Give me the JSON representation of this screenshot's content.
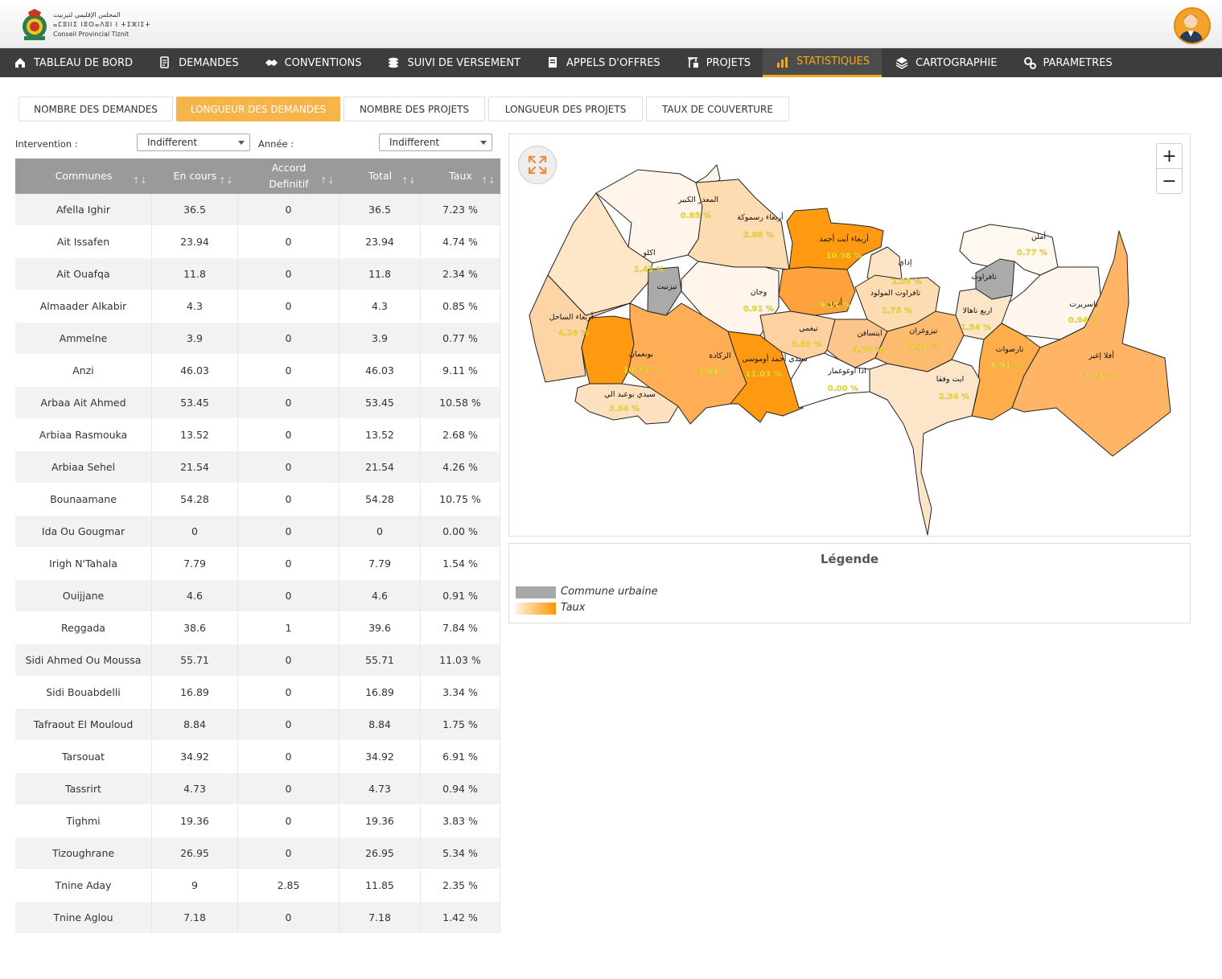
{
  "header": {
    "logo_line1": "المجلس الإقليمي لتيزنيت",
    "logo_line2": "ⴰⵎⵓⵏⵏⵉ ⵏⵓⵙⴰⴷⵓⵏ ⵏ ⵜⵉⵣⵏⵉⵜ",
    "logo_line3": "Conseil Provincial Tiznit"
  },
  "nav": [
    {
      "label": "TABLEAU DE BORD",
      "icon": "home-icon"
    },
    {
      "label": "DEMANDES",
      "icon": "document-edit-icon"
    },
    {
      "label": "CONVENTIONS",
      "icon": "handshake-icon"
    },
    {
      "label": "SUIVI DE VERSEMENT",
      "icon": "coins-icon"
    },
    {
      "label": "APPELS D'OFFRES",
      "icon": "file-stack-icon"
    },
    {
      "label": "PROJETS",
      "icon": "crane-icon"
    },
    {
      "label": "STATISTIQUES",
      "icon": "bar-chart-icon",
      "active": true
    },
    {
      "label": "CARTOGRAPHIE",
      "icon": "layers-icon"
    },
    {
      "label": "PARAMETRES",
      "icon": "gears-icon"
    }
  ],
  "tabs": [
    {
      "label": "NOMBRE DES DEMANDES"
    },
    {
      "label": "LONGUEUR DES DEMANDES",
      "active": true
    },
    {
      "label": "NOMBRE DES PROJETS"
    },
    {
      "label": "LONGUEUR DES PROJETS"
    },
    {
      "label": "TAUX DE COUVERTURE"
    }
  ],
  "filters": {
    "intervention_label": "Intervention :",
    "intervention_value": "Indifferent",
    "annee_label": "Année :",
    "annee_value": "Indifferent"
  },
  "table": {
    "headers": [
      "Communes",
      "En cours",
      "Accord Definitif",
      "Total",
      "Taux"
    ],
    "rows": [
      [
        "Afella Ighir",
        "36.5",
        "0",
        "36.5",
        "7.23 %"
      ],
      [
        "Ait Issafen",
        "23.94",
        "0",
        "23.94",
        "4.74 %"
      ],
      [
        "Ait Ouafqa",
        "11.8",
        "0",
        "11.8",
        "2.34 %"
      ],
      [
        "Almaader Alkabir",
        "4.3",
        "0",
        "4.3",
        "0.85 %"
      ],
      [
        "Ammelne",
        "3.9",
        "0",
        "3.9",
        "0.77 %"
      ],
      [
        "Anzi",
        "46.03",
        "0",
        "46.03",
        "9.11 %"
      ],
      [
        "Arbaa Ait Ahmed",
        "53.45",
        "0",
        "53.45",
        "10.58 %"
      ],
      [
        "Arbiaa Rasmouka",
        "13.52",
        "0",
        "13.52",
        "2.68 %"
      ],
      [
        "Arbiaa Sehel",
        "21.54",
        "0",
        "21.54",
        "4.26 %"
      ],
      [
        "Bounaamane",
        "54.28",
        "0",
        "54.28",
        "10.75 %"
      ],
      [
        "Ida Ou Gougmar",
        "0",
        "0",
        "0",
        "0.00 %"
      ],
      [
        "Irigh N'Tahala",
        "7.79",
        "0",
        "7.79",
        "1.54 %"
      ],
      [
        "Ouijjane",
        "4.6",
        "0",
        "4.6",
        "0.91 %"
      ],
      [
        "Reggada",
        "38.6",
        "1",
        "39.6",
        "7.84 %"
      ],
      [
        "Sidi Ahmed Ou Moussa",
        "55.71",
        "0",
        "55.71",
        "11.03 %"
      ],
      [
        "Sidi Bouabdelli",
        "16.89",
        "0",
        "16.89",
        "3.34 %"
      ],
      [
        "Tafraout El Mouloud",
        "8.84",
        "0",
        "8.84",
        "1.75 %"
      ],
      [
        "Tarsouat",
        "34.92",
        "0",
        "34.92",
        "6.91 %"
      ],
      [
        "Tassrirt",
        "4.73",
        "0",
        "4.73",
        "0.94 %"
      ],
      [
        "Tighmi",
        "19.36",
        "0",
        "19.36",
        "3.83 %"
      ],
      [
        "Tizoughrane",
        "26.95",
        "0",
        "26.95",
        "5.34 %"
      ],
      [
        "Tnine Aday",
        "9",
        "2.85",
        "11.85",
        "2.35 %"
      ],
      [
        "Tnine Aglou",
        "7.18",
        "0",
        "7.18",
        "1.42 %"
      ]
    ]
  },
  "map": {
    "zoom_in": "+",
    "zoom_out": "−",
    "labels": [
      {
        "name": "المعدر الكبير",
        "pct": "0.85 %"
      },
      {
        "name": "أربعاء رسموكة",
        "pct": "2.68 %"
      },
      {
        "name": "أربعاء آيت أحمد",
        "pct": "10.58 %"
      },
      {
        "name": "أملن",
        "pct": "0.77 %"
      },
      {
        "name": "اكلو",
        "pct": "1.42 %"
      },
      {
        "name": "تيزنيت",
        "pct": ""
      },
      {
        "name": "إداي",
        "pct": "2.35 %"
      },
      {
        "name": "تافراوت",
        "pct": ""
      },
      {
        "name": "وجان",
        "pct": "0.91 %"
      },
      {
        "name": "أنزي",
        "pct": "9.11 %"
      },
      {
        "name": "تافراوت المولود",
        "pct": "1.75 %"
      },
      {
        "name": "تاسريرت",
        "pct": "0.94 %"
      },
      {
        "name": "أربعاء الساحل",
        "pct": "4.26 %"
      },
      {
        "name": "اربع ناهالا",
        "pct": "1.54 %"
      },
      {
        "name": "تيغمي",
        "pct": "3.83 %"
      },
      {
        "name": "ايتسافن",
        "pct": "4.74 %"
      },
      {
        "name": "تيزوغران",
        "pct": "5.34 %"
      },
      {
        "name": "بونعمان",
        "pct": "10.75 %"
      },
      {
        "name": "الركادة",
        "pct": "7.84 %"
      },
      {
        "name": "سيدي أحمد أوموسى",
        "pct": "11.03 %"
      },
      {
        "name": "تارصوات",
        "pct": "6.91 %"
      },
      {
        "name": "أفلا إغير",
        "pct": "7.23 %"
      },
      {
        "name": "ادا اوغوغمار",
        "pct": "0.00 %"
      },
      {
        "name": "ايت وفقا",
        "pct": "2.34 %"
      },
      {
        "name": "سيدي بوعبد الي",
        "pct": "3.34 %"
      }
    ]
  },
  "legend": {
    "title": "Légende",
    "urbaine": "Commune urbaine",
    "taux": "Taux",
    "urbaine_color": "#a8a8a8",
    "taux_from": "#fff3e3",
    "taux_to": "#ff9500"
  },
  "colors": {
    "accent": "#f5a623",
    "nav_bg": "#3d3d3d",
    "table_header": "#9a9a9a"
  }
}
